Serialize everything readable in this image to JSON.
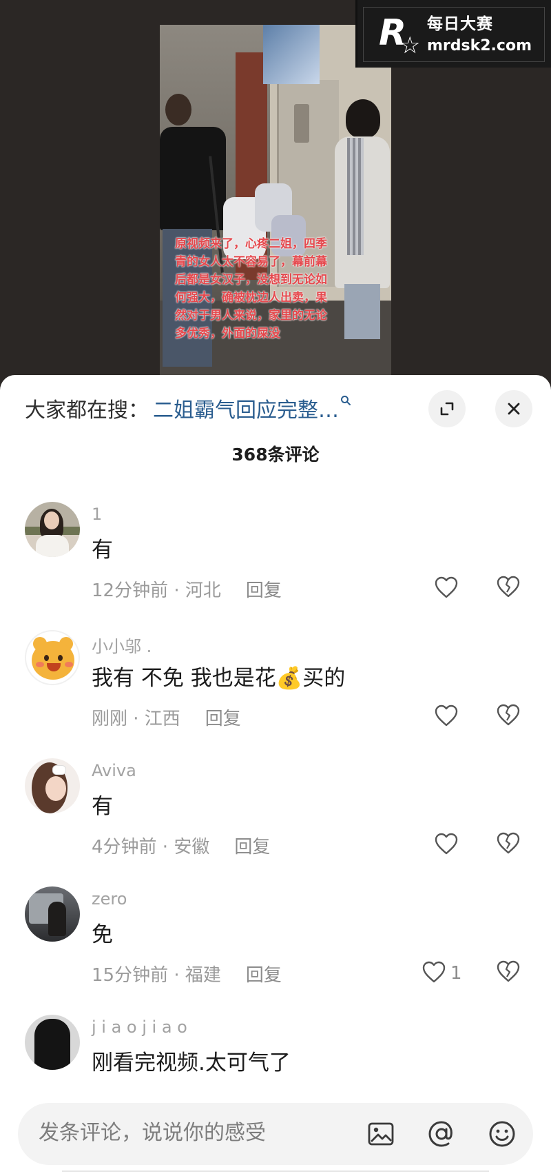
{
  "video": {
    "caption": "原视频来了，心疼二姐，四季青的女人太不容易了，幕前幕后都是女汉子，没想到无论如何强大，确被枕边人出卖，果然对于男人来说，家里的无论多优秀，外面的屎没"
  },
  "watermark": {
    "logo_letter": "R",
    "logo_sub": "每日大赛",
    "site_name": "每日大赛",
    "site_url": "mrdsk2.com"
  },
  "header": {
    "search_prefix": "大家都在搜：",
    "search_term": "二姐霸气回应完整…",
    "comment_count": "368条评论",
    "icons": {
      "search": "search-icon",
      "expand": "expand-icon",
      "close": "close-icon"
    }
  },
  "comments": [
    {
      "user": "1",
      "text": "有",
      "time": "12分钟前 · 河北",
      "reply": "回复",
      "likes": ""
    },
    {
      "user": "小小邬 .",
      "text": "我有 不免 我也是花💰买的",
      "time": "刚刚 · 江西",
      "reply": "回复",
      "likes": ""
    },
    {
      "user": "Aviva",
      "text": "有",
      "time": "4分钟前 · 安徽",
      "reply": "回复",
      "likes": ""
    },
    {
      "user": "zero",
      "text": "免",
      "time": "15分钟前 · 福建",
      "reply": "回复",
      "likes": "1"
    },
    {
      "user": "j i a o j i a o",
      "text": "刚看完视频.太可气了",
      "time": "",
      "reply": "",
      "likes": ""
    }
  ],
  "input_bar": {
    "placeholder": "发条评论，说说你的感受",
    "icons": [
      "image-icon",
      "at-icon",
      "emoji-icon"
    ]
  },
  "colors": {
    "link": "#2a5d8f",
    "caption_red": "#e5484d",
    "muted": "#9a9a9a"
  }
}
